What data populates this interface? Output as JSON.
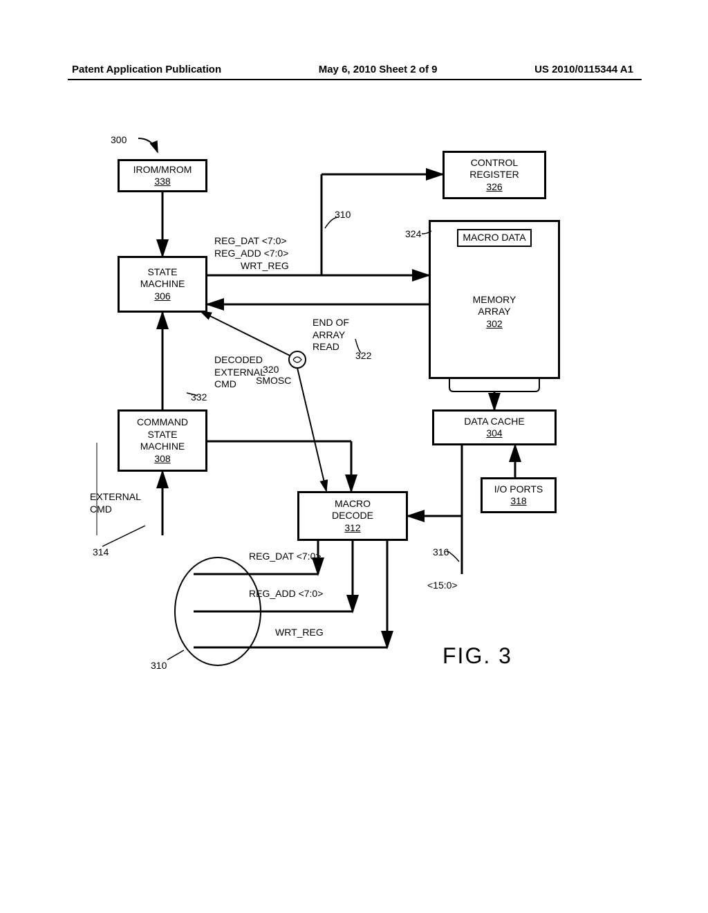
{
  "header": {
    "left": "Patent Application Publication",
    "center": "May 6, 2010  Sheet 2 of 9",
    "right": "US 2010/0115344 A1"
  },
  "diagram_ref": "300",
  "blocks": {
    "irom": {
      "label": "IROM/MROM",
      "ref": "338"
    },
    "state_machine": {
      "label": "STATE\nMACHINE",
      "ref": "306"
    },
    "cmd_state_machine": {
      "label": "COMMAND\nSTATE\nMACHINE",
      "ref": "308"
    },
    "control_register": {
      "label": "CONTROL\nREGISTER",
      "ref": "326"
    },
    "memory_array": {
      "label": "MEMORY\nARRAY",
      "ref": "302",
      "macro_data": "MACRO DATA",
      "macro_ref": "324"
    },
    "data_cache": {
      "label": "DATA CACHE",
      "ref": "304"
    },
    "io_ports": {
      "label": "I/O PORTS",
      "ref": "318"
    },
    "macro_decode": {
      "label": "MACRO\nDECODE",
      "ref": "312"
    }
  },
  "signals": {
    "reg_dat": "REG_DAT <7:0>",
    "reg_add": "REG_ADD <7:0>",
    "wrt_reg": "WRT_REG",
    "end_array_read": "END OF\nARRAY\nREAD",
    "end_array_ref": "322",
    "smosc": "SMOSC",
    "smosc_ref": "320",
    "decoded_ext_cmd": "DECODED\nEXTERNAL\nCMD",
    "decoded_ext_cmd_ref": "332",
    "external_cmd": "EXTERNAL\nCMD",
    "external_cmd_ref": "314",
    "bus_310": "310",
    "bus_316_ref": "316",
    "bus_316_label": "<15:0>",
    "out_reg_dat": "REG_DAT <7:0>",
    "out_reg_add": "REG_ADD <7:0>",
    "out_wrt_reg": "WRT_REG",
    "out_bus_ref": "310"
  },
  "fig_caption": "FIG. 3"
}
